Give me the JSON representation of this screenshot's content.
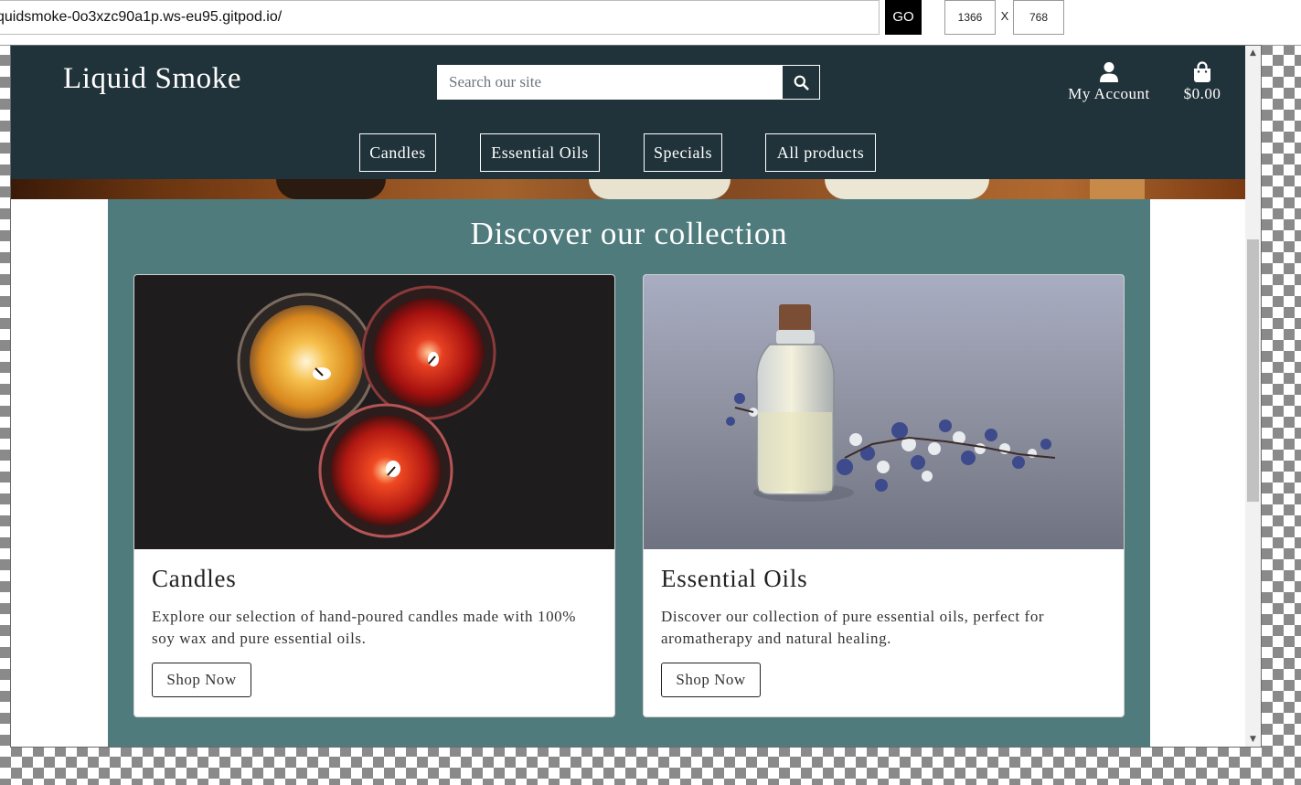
{
  "toolbar": {
    "url": "quidsmoke-0o3xzc90a1p.ws-eu95.gitpod.io/",
    "go_label": "GO",
    "width_value": "1366",
    "separator": "X",
    "height_value": "768"
  },
  "site": {
    "logo": "Liquid Smoke",
    "search": {
      "placeholder": "Search our site",
      "icon": "search-icon"
    },
    "account_label": "My Account",
    "account_icon": "user-icon",
    "bag_total": "$0.00",
    "bag_icon": "shopping-bag-icon",
    "nav": [
      {
        "label": "Candles"
      },
      {
        "label": "Essential Oils"
      },
      {
        "label": "Specials"
      },
      {
        "label": "All products"
      }
    ],
    "collection": {
      "title": "Discover our collection",
      "cards": [
        {
          "title": "Candles",
          "text": "Explore our selection of hand-poured candles made with 100% soy wax and pure essential oils.",
          "button": "Shop Now"
        },
        {
          "title": "Essential Oils",
          "text": "Discover our collection of pure essential oils, perfect for aromatherapy and natural healing.",
          "button": "Shop Now"
        }
      ]
    }
  },
  "colors": {
    "header_bg": "#21333a",
    "collection_bg": "#4f7b7d",
    "text_on_dark": "#ffffff"
  }
}
